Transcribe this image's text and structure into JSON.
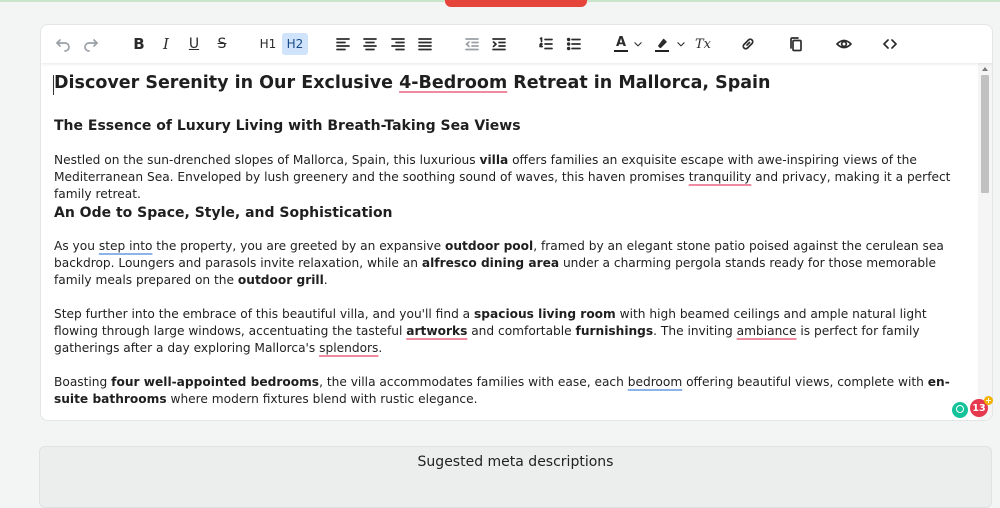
{
  "toolbar": {
    "undo_icon": "undo-icon",
    "redo_icon": "redo-icon",
    "bold_label": "B",
    "italic_label": "I",
    "underline_label": "U",
    "strike_label": "S",
    "h1_label": "H1",
    "h2_label": "H2",
    "active_heading": "H2",
    "text_color_label": "A",
    "clear_format_label": "Tx",
    "active_color": "#cfe3fb"
  },
  "document": {
    "title_parts": [
      "Discover Serenity in Our Exclusive ",
      "4-Bedroom",
      " Retreat in Mallorca, Spain"
    ],
    "section1_heading": "The Essence of Luxury Living with Breath-Taking Sea Views",
    "p1": {
      "a": "Nestled on the sun-drenched slopes of Mallorca, Spain, this luxurious ",
      "b_villa": "villa",
      "c": " offers families an exquisite escape with awe-inspiring views of the Mediterranean Sea. Enveloped by lush greenery and the soothing sound of waves, this haven promises ",
      "d_tranquility": "tranquility",
      "e": " and privacy, making it a perfect family retreat."
    },
    "section2_heading": "An Ode to Space, Style, and Sophistication",
    "p2": {
      "a": "As you ",
      "b_step": "step into",
      "c": " the property, you are greeted by an expansive ",
      "d_pool": "outdoor pool",
      "e": ", framed by an elegant stone patio poised against the cerulean sea backdrop. Loungers and parasols invite relaxation, while an ",
      "f_alfresco": "alfresco dining area",
      "g": " under a charming pergola stands ready for those memorable family meals prepared on the ",
      "h_grill": "outdoor grill",
      "i": "."
    },
    "p3": {
      "a": "Step further into the embrace of this beautiful villa, and you'll find a ",
      "b_living": "spacious living room",
      "c": " with high beamed ceilings and ample natural light flowing through large windows, accentuating the tasteful ",
      "d_artworks": "artworks",
      "e": " and comfortable ",
      "f_furnishings": "furnishings",
      "g": ". The inviting ",
      "h_ambiance": "ambiance",
      "i": " is perfect for family gatherings after a day exploring Mallorca's ",
      "j_splendors": "splendors",
      "k": "."
    },
    "p4": {
      "a": "Boasting ",
      "b_bedrooms": "four well-appointed bedrooms",
      "c": ", the villa accommodates families with ease, each ",
      "d_bedroom": "bedroom",
      "e": " offering beautiful views, complete with ",
      "f_ensuite": "en-suite bathrooms",
      "g": " where modern fixtures blend with rustic elegance."
    }
  },
  "extension": {
    "badge_count": "13",
    "badge_plus": "+"
  },
  "meta_panel": {
    "title": "Sugested meta descriptions"
  },
  "colors": {
    "spell_underline": "#f08aa0",
    "grammar_underline": "#8bb4e8",
    "badge": "#e6394f",
    "top_tab": "#e5453b"
  }
}
